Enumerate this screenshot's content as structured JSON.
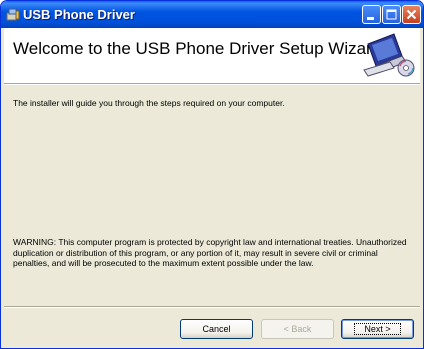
{
  "window": {
    "title": "USB Phone Driver",
    "title_icon": "installer-icon"
  },
  "titlebar_buttons": {
    "minimize": "minimize-icon",
    "maximize": "maximize-icon",
    "close": "close-icon"
  },
  "header": {
    "title": "Welcome to the USB Phone Driver Setup Wizard",
    "art": "computer-setup-icon"
  },
  "body": {
    "intro": "The installer will guide you through the steps required on your computer.",
    "warning": "WARNING: This computer program is protected by copyright law and international treaties. Unauthorized duplication or distribution of this program, or any portion of it, may result in severe civil or criminal penalties, and will be prosecuted to the maximum extent possible under the law."
  },
  "buttons": {
    "cancel": "Cancel",
    "back": "< Back",
    "next": "Next >"
  },
  "colors": {
    "titlebar": "#0054e3",
    "dialog_bg": "#ece9d8",
    "close_button": "#c4401e"
  }
}
